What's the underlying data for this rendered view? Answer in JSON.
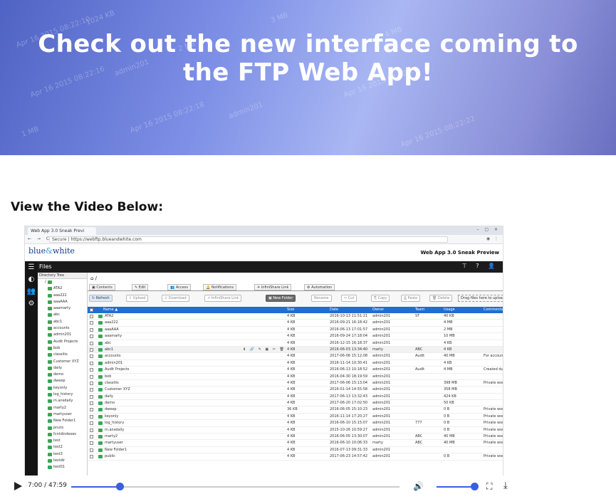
{
  "hero": {
    "title": "Check out the new interface coming to the FTP Web App!",
    "ghost_text": [
      "Apr 16 2015 08:22:10",
      "1024 KB",
      "Apr 16 2015 08:22:16",
      "admin201",
      "1 MB",
      "Apr 16 2015 08:22:18",
      "admin201",
      "3 MB",
      "Apr 16 2015 08:22:20",
      "4 MB",
      "Apr 16 2015 08:22:22",
      "2 MB"
    ]
  },
  "section_heading": "View the Video Below:",
  "video": {
    "browser": {
      "tab_title": "Web App 3.0 Sneak Previ",
      "url": "Secure | https://webftp.blueandwhite.com",
      "nav_icons": "← → C",
      "window_controls": "– ▢ ×"
    },
    "brand": {
      "logo_part1": "blue",
      "logo_amp": "&",
      "logo_part2": "white",
      "preview_label": "Web App 3.0 Sneak Preview"
    },
    "appbar": {
      "title": "Files",
      "right_icons": "⊤ ? 👤"
    },
    "rail_icons": [
      "☰",
      "◐",
      "👥",
      "⚙"
    ],
    "tree": {
      "header": "Directory Tree",
      "root": "/",
      "items": [
        "ATA2",
        "aaa222",
        "aaaAAA",
        "aaamarty",
        "abc",
        "abc1",
        "accounts",
        "admin201",
        "Audit Projects",
        "bob",
        "classitis",
        "Customer XYZ",
        "daily",
        "demo",
        "dweep",
        "keyonly",
        "log_history",
        "m.ansdaily",
        "marty2",
        "martyuser",
        "New Folder1",
        "pnuts",
        "fcntdindexes",
        "test",
        "test2",
        "test3",
        "testdir",
        "test01"
      ]
    },
    "main": {
      "breadcrumb": "⌂ /",
      "tabs": [
        "▣ Contents",
        "✎ Edit",
        "👥 Access",
        "🔔 Notifications",
        "✈ InfiniShare Link",
        "⚙ Automation"
      ],
      "tools": [
        {
          "label": "↻ Refresh",
          "style": "blue"
        },
        {
          "label": "⇪ Upload",
          "style": ""
        },
        {
          "label": "⇩ Download",
          "style": ""
        },
        {
          "label": "⇗ InfiniShare Link",
          "style": ""
        },
        {
          "label": "▣ New Folder",
          "style": "on"
        },
        {
          "label": "Rename",
          "style": ""
        },
        {
          "label": "✂ Cut",
          "style": ""
        },
        {
          "label": "⎘ Copy",
          "style": ""
        },
        {
          "label": "⎙ Paste",
          "style": ""
        },
        {
          "label": "🗑 Delete",
          "style": ""
        }
      ],
      "drop_label": "Drag files here to upload",
      "columns": [
        "Name ▲",
        "Size",
        "Date",
        "Owner",
        "Team",
        "Usage",
        "Comments"
      ],
      "rows": [
        [
          "ATA2",
          "4 KB",
          "2016-10-13 11:51:21",
          "admin201",
          "ST",
          "40 KB",
          ""
        ],
        [
          "aaa222",
          "4 KB",
          "2016-09-21 16:18:42",
          "admin201",
          "",
          "4 MB",
          ""
        ],
        [
          "aaaAAA",
          "4 KB",
          "2016-06-13 17:01:57",
          "admin201",
          "",
          "2 MB",
          ""
        ],
        [
          "aaamarty",
          "4 KB",
          "2016-09-24 17:18:04",
          "admin201",
          "",
          "10 MB",
          ""
        ],
        [
          "abc",
          "4 KB",
          "2016-12-15 16:18:37",
          "admin201",
          "",
          "4 KB",
          ""
        ],
        [
          "abc1",
          "4 KB",
          "2016-06-03 13:34:40",
          "marty",
          "ABC",
          "4 KB",
          ""
        ],
        [
          "accounts",
          "4 KB",
          "2017-06-06 15:12:08",
          "admin201",
          "Audit",
          "40 MB",
          "For accounts"
        ],
        [
          "admin201",
          "4 KB",
          "2016-11-14 10:30:41",
          "admin201",
          "",
          "4 KB",
          ""
        ],
        [
          "Audit Projects",
          "4 KB",
          "2016-06-13 10:18:52",
          "admin201",
          "Audit",
          "4 MB",
          "Created during au"
        ],
        [
          "bob",
          "4 KB",
          "2016-04-30 18:19:59",
          "admin201",
          "",
          "",
          ""
        ],
        [
          "classitis",
          "4 KB",
          "2017-06-06 15:13:04",
          "admin201",
          "",
          "398 MB",
          "Private workspac"
        ],
        [
          "Customer XYZ",
          "4 KB",
          "2016-01-14 14:55:58",
          "admin201",
          "",
          "358 MB",
          ""
        ],
        [
          "daily",
          "4 KB",
          "2017-06-13 13:32:43",
          "admin201",
          "",
          "424 KB",
          ""
        ],
        [
          "demo",
          "4 KB",
          "2017-06-20 17:02:50",
          "admin201",
          "",
          "50 KB",
          ""
        ],
        [
          "dweep",
          "36 KB",
          "2016-06-05 15:10:23",
          "admin201",
          "",
          "0 B",
          "Private workspac"
        ],
        [
          "keyonly",
          "4 KB",
          "2016-11-14 17:20:27",
          "admin201",
          "",
          "0 B",
          "Private workspac"
        ],
        [
          "log_history",
          "4 KB",
          "2016-06-10 15:15:07",
          "admin201",
          "777",
          "0 B",
          "Private workspac"
        ],
        [
          "m.ansdaily",
          "4 KB",
          "2015-10-26 10:59:27",
          "admin201",
          "",
          "0 B",
          "Private workspac"
        ],
        [
          "marty2",
          "4 KB",
          "2016-06-05 13:30:07",
          "admin201",
          "ABC",
          "40 MB",
          "Private workspac"
        ],
        [
          "martyuser",
          "4 KB",
          "2016-06-10 10:06:33",
          "marty",
          "ABC",
          "40 MB",
          "Private workspac"
        ],
        [
          "New Folder1",
          "4 KB",
          "2016-07-13 09:31:33",
          "admin201",
          "",
          "",
          ""
        ],
        [
          "public",
          "4 KB",
          "2017-06-23 14:57:42",
          "admin201",
          "",
          "0 B",
          "Private workspac"
        ]
      ],
      "row_tools": "⬇ 🔗 ✎ ▣ ✂ 🗑"
    }
  },
  "player": {
    "time": "7:00 / 47:59",
    "progress": 0.148,
    "volume": 1.0
  }
}
